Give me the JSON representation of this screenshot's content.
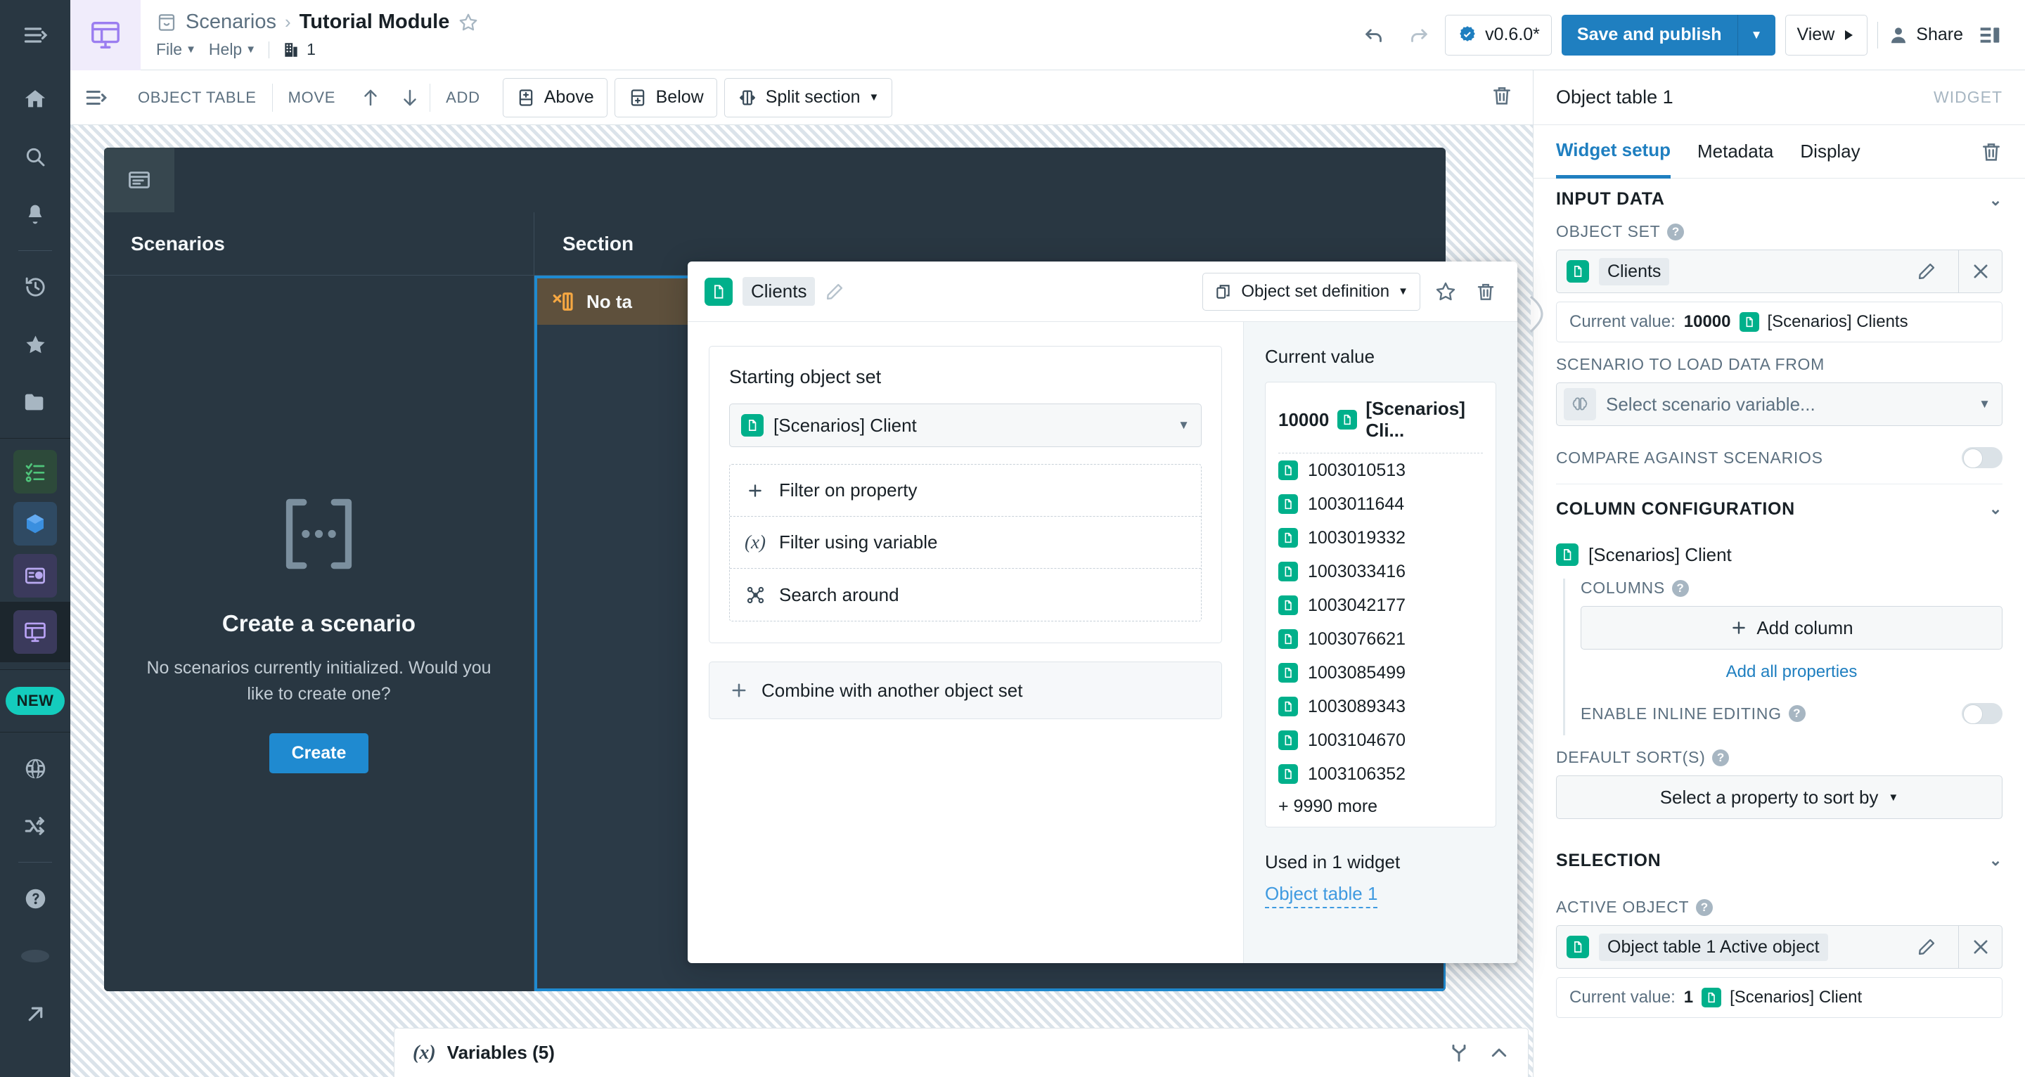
{
  "header": {
    "breadcrumb_root": "Scenarios",
    "breadcrumb_sep": "›",
    "title": "Tutorial Module",
    "menus": [
      "File",
      "Help"
    ],
    "building_count": "1",
    "version_badge": "v0.6.0*",
    "save_label": "Save and publish",
    "view_label": "View",
    "share_label": "Share",
    "icons": {
      "undo": "undo-icon",
      "redo": "redo-icon",
      "logo": "module-logo-icon",
      "favorite": "star-icon",
      "panel": "panel-toggle-icon"
    }
  },
  "toolbar": {
    "widget_type": "OBJECT TABLE",
    "move_label": "MOVE",
    "add_label": "ADD",
    "above_label": "Above",
    "below_label": "Below",
    "split_label": "Split section"
  },
  "canvas": {
    "column_left_header": "Scenarios",
    "column_right_header": "Section",
    "no_table_label": "No ta",
    "empty_title": "Create a scenario",
    "empty_subtitle": "No scenarios currently initialized. Would you like to create one?",
    "create_button": "Create"
  },
  "variables_bar": {
    "label": "Variables (5)"
  },
  "modal": {
    "chip_name": "Clients",
    "object_set_definition_label": "Object set definition",
    "starting_object_set_title": "Starting object set",
    "starting_object_set_value": "[Scenarios] Client",
    "actions": [
      {
        "label": "Filter on property",
        "icon": "plus-icon"
      },
      {
        "label": "Filter using variable",
        "icon": "variable-fx-icon"
      },
      {
        "label": "Search around",
        "icon": "search-around-icon"
      }
    ],
    "combine_label": "Combine with another object set",
    "current_value_title": "Current value",
    "current_value_count": "10000",
    "current_value_type": "[Scenarios] Cli...",
    "object_ids": [
      "1003010513",
      "1003011644",
      "1003019332",
      "1003033416",
      "1003042177",
      "1003076621",
      "1003085499",
      "1003089343",
      "1003104670",
      "1003106352"
    ],
    "more_label": "+ 9990 more",
    "used_in_label": "Used in 1 widget",
    "used_in_link": "Object table 1"
  },
  "right_panel": {
    "title": "Object table 1",
    "widget_tag": "WIDGET",
    "tabs": [
      {
        "label": "Widget setup",
        "active": true
      },
      {
        "label": "Metadata",
        "active": false
      },
      {
        "label": "Display",
        "active": false
      }
    ],
    "input_data_header": "INPUT DATA",
    "object_set_label": "OBJECT SET",
    "object_set_chip": "Clients",
    "object_set_current_label": "Current value:",
    "object_set_current_count": "10000",
    "object_set_current_type": "[Scenarios] Clients",
    "scenario_label": "SCENARIO TO LOAD DATA FROM",
    "scenario_placeholder": "Select scenario variable...",
    "compare_label": "COMPARE AGAINST SCENARIOS",
    "column_config_header": "COLUMN CONFIGURATION",
    "object_type": "[Scenarios] Client",
    "columns_label": "COLUMNS",
    "add_column_label": "Add column",
    "add_all_properties_label": "Add all properties",
    "inline_editing_label": "ENABLE INLINE EDITING",
    "default_sorts_label": "DEFAULT SORT(S)",
    "sort_placeholder": "Select a property to sort by",
    "selection_header": "SELECTION",
    "active_object_label": "ACTIVE OBJECT",
    "active_object_chip": "Object table 1 Active object",
    "active_object_current_label": "Current value:",
    "active_object_current_count": "1",
    "active_object_current_type": "[Scenarios] Client"
  },
  "sidebar": {
    "items": [
      "home-icon",
      "search-icon",
      "bell-icon",
      "history-icon",
      "star-icon",
      "folder-icon",
      "checklist-icon",
      "cube-icon",
      "media-icon",
      "workshop-icon",
      "globe-icon",
      "shuffle-icon",
      "help-icon",
      "avatar-icon",
      "external-link-icon"
    ],
    "new_badge": "NEW"
  },
  "colors": {
    "accent_blue": "#1f7fc0",
    "object_teal": "#00b08b",
    "canvas_dark": "#293742",
    "warn_orange": "#f5a742",
    "new_teal": "#14ccbd"
  }
}
